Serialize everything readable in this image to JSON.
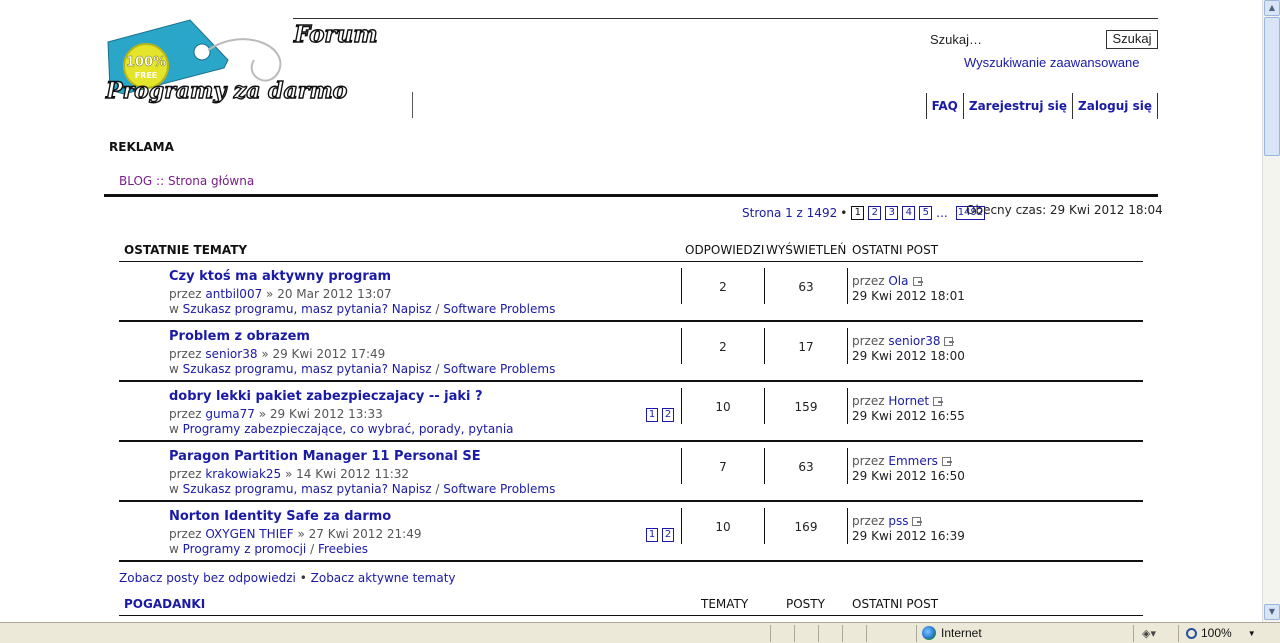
{
  "header": {
    "logo_top": "Forum",
    "logo_bottom": "Programy za darmo",
    "badge_pct": "100%",
    "badge_free": "FREE",
    "search_label": "Szukaj…",
    "search_button": "Szukaj",
    "advanced_search": "Wyszukiwanie zaawansowane",
    "nav": [
      "FAQ",
      "Zarejestruj się",
      "Zaloguj się"
    ]
  },
  "reklama": "REKLAMA",
  "breadcrumb": "BLOG :: Strona główna",
  "pagination": {
    "summary": "Strona 1 z 1492",
    "bullet": "•",
    "pages": [
      "1",
      "2",
      "3",
      "4",
      "5"
    ],
    "dots": "...",
    "last": "1492",
    "current_time": "Obecny czas: 29 Kwi 2012 18:04"
  },
  "topics_header": {
    "title": "OSTATNIE TEMATY",
    "replies": "ODPOWIEDZI",
    "views": "WYŚWIETLEŃ",
    "last_post": "OSTATNI POST"
  },
  "topics": [
    {
      "title": "Czy ktoś ma aktywny program",
      "by": "przez",
      "author": "antbil007",
      "date": "» 20 Mar 2012 13:07",
      "in": "w",
      "forum1": "Szukasz programu, masz pytania? Napisz",
      "slash": "/",
      "forum2": "Software Problems",
      "pages": [],
      "replies": "2",
      "views": "63",
      "last_by": "przez",
      "last_author": "Ola",
      "last_date": "29 Kwi 2012 18:01"
    },
    {
      "title": "Problem z obrazem",
      "by": "przez",
      "author": "senior38",
      "date": "» 29 Kwi 2012 17:49",
      "in": "w",
      "forum1": "Szukasz programu, masz pytania? Napisz",
      "slash": "/",
      "forum2": "Software Problems",
      "pages": [],
      "replies": "2",
      "views": "17",
      "last_by": "przez",
      "last_author": "senior38",
      "last_date": "29 Kwi 2012 18:00"
    },
    {
      "title": "dobry lekki pakiet zabezpieczajacy -- jaki ?",
      "by": "przez",
      "author": "guma77",
      "date": "» 29 Kwi 2012 13:33",
      "in": "w",
      "forum1": "Programy zabezpieczające, co wybrać, porady, pytania",
      "slash": "",
      "forum2": "",
      "pages": [
        "1",
        "2"
      ],
      "replies": "10",
      "views": "159",
      "last_by": "przez",
      "last_author": "Hornet",
      "last_date": "29 Kwi 2012 16:55"
    },
    {
      "title": "Paragon Partition Manager 11 Personal SE",
      "by": "przez",
      "author": "krakowiak25",
      "date": "» 14 Kwi 2012 11:32",
      "in": "w",
      "forum1": "Szukasz programu, masz pytania? Napisz",
      "slash": "/",
      "forum2": "Software Problems",
      "pages": [],
      "replies": "7",
      "views": "63",
      "last_by": "przez",
      "last_author": "Emmers",
      "last_date": "29 Kwi 2012 16:50"
    },
    {
      "title": "Norton Identity Safe za darmo",
      "by": "przez",
      "author": "OXYGEN THIEF",
      "date": "» 27 Kwi 2012 21:49",
      "in": "w",
      "forum1": "Programy z promocji",
      "slash": "/",
      "forum2": "Freebies",
      "pages": [
        "1",
        "2"
      ],
      "replies": "10",
      "views": "169",
      "last_by": "przez",
      "last_author": "pss",
      "last_date": "29 Kwi 2012 16:39"
    }
  ],
  "footer_links": {
    "unanswered": "Zobacz posty bez odpowiedzi",
    "sep": "•",
    "active": "Zobacz aktywne tematy"
  },
  "pogadanki_header": {
    "title": "POGADANKI",
    "topics": "TEMATY",
    "posts": "POSTY",
    "last_post": "OSTATNI POST"
  },
  "statusbar": {
    "zone": "Internet",
    "zoom": "100%"
  }
}
